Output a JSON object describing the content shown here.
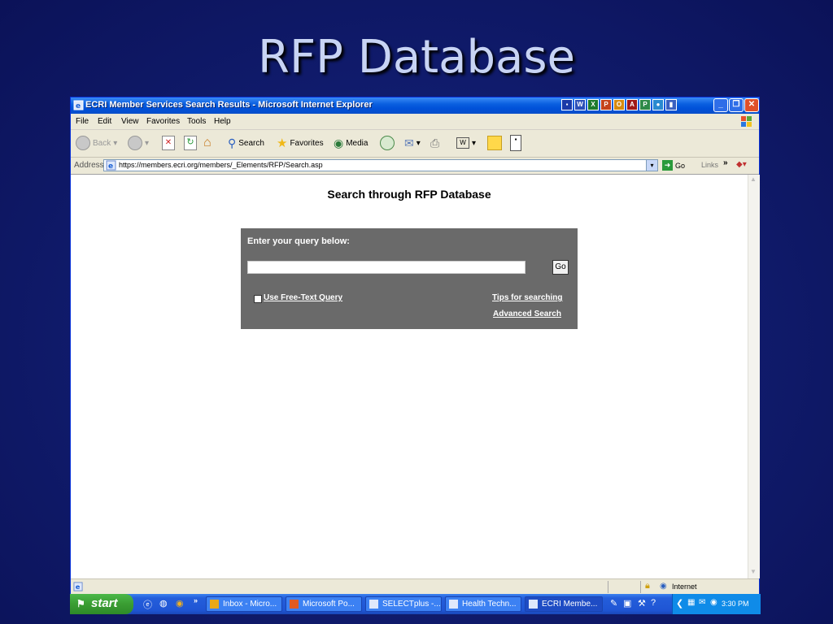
{
  "slide": {
    "title": "RFP Database"
  },
  "window": {
    "title": "ECRI Member Services Search Results - Microsoft Internet Explorer",
    "menu": [
      "File",
      "Edit",
      "View",
      "Favorites",
      "Tools",
      "Help"
    ],
    "toolbar": {
      "back": "Back",
      "search": "Search",
      "favorites": "Favorites",
      "media": "Media"
    },
    "address": {
      "label": "Address",
      "url": "https://members.ecri.org/members/_Elements/RFP/Search.asp",
      "go": "Go",
      "links": "Links"
    }
  },
  "page": {
    "heading": "Search through RFP Database",
    "query_label": "Enter your query below:",
    "query_value": "",
    "go_button": "Go",
    "free_text": "Use Free-Text Query",
    "tips": "Tips for searching",
    "advanced": "Advanced Search"
  },
  "status": {
    "zone": "Internet"
  },
  "taskbar": {
    "start": "start",
    "tasks": [
      "Inbox - Micro...",
      "Microsoft Po...",
      "SELECTplus -...",
      "Health Techn...",
      "ECRI Membe..."
    ],
    "clock": "3:30 PM"
  },
  "colors": {
    "xp_blue": "#0050d8",
    "panel_gray": "#6a6a6a",
    "start_green": "#3a9d33",
    "slide_bg": "#111d70"
  }
}
